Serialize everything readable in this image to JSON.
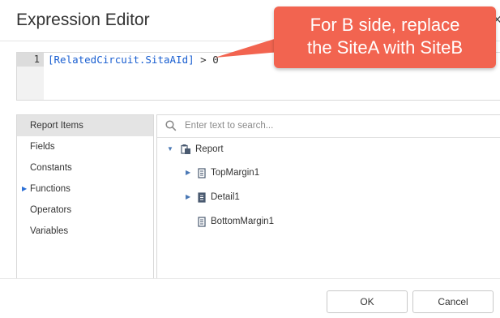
{
  "dialog": {
    "title": "Expression Editor",
    "close_glyph": "×"
  },
  "callout": {
    "text": "For B side, replace\nthe SiteA with SiteB",
    "color": "#f26450"
  },
  "editor": {
    "line_number": "1",
    "field_token": "[RelatedCircuit.SitaAId]",
    "rest": " > 0"
  },
  "categories": [
    {
      "label": "Report Items",
      "selected": true,
      "expandable": false
    },
    {
      "label": "Fields",
      "selected": false,
      "expandable": false
    },
    {
      "label": "Constants",
      "selected": false,
      "expandable": false
    },
    {
      "label": "Functions",
      "selected": false,
      "expandable": true
    },
    {
      "label": "Operators",
      "selected": false,
      "expandable": false
    },
    {
      "label": "Variables",
      "selected": false,
      "expandable": false
    }
  ],
  "search": {
    "placeholder": "Enter text to search...",
    "value": ""
  },
  "tree": {
    "root": {
      "label": "Report",
      "icon": "report-icon",
      "expanded": true
    },
    "children": [
      {
        "label": "TopMargin1",
        "icon": "band-icon",
        "expandable": true
      },
      {
        "label": "Detail1",
        "icon": "band-filled-icon",
        "expandable": true
      },
      {
        "label": "BottomMargin1",
        "icon": "band-icon",
        "expandable": false
      }
    ]
  },
  "buttons": {
    "ok": "OK",
    "cancel": "Cancel"
  }
}
